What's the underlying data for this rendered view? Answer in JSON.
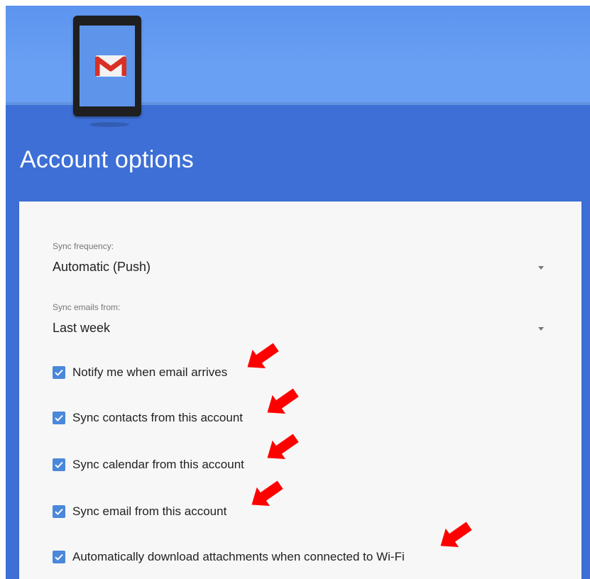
{
  "header": {
    "title": "Account options",
    "illustration_icon": "gmail-envelope-icon"
  },
  "settings": {
    "sync_frequency": {
      "label": "Sync frequency:",
      "value": "Automatic (Push)"
    },
    "sync_emails_from": {
      "label": "Sync emails from:",
      "value": "Last week"
    },
    "checkboxes": [
      {
        "label": "Notify me when email arrives",
        "checked": true
      },
      {
        "label": "Sync contacts from this account",
        "checked": true
      },
      {
        "label": "Sync calendar from this account",
        "checked": true
      },
      {
        "label": "Sync email from this account",
        "checked": true
      },
      {
        "label": "Automatically download attachments when connected to Wi-Fi",
        "checked": true
      }
    ]
  },
  "colors": {
    "top_banner": "#6aa0f3",
    "header_blue": "#3d6fd6",
    "checkbox_blue": "#4a88da",
    "annotation_arrow": "#ff0000"
  }
}
